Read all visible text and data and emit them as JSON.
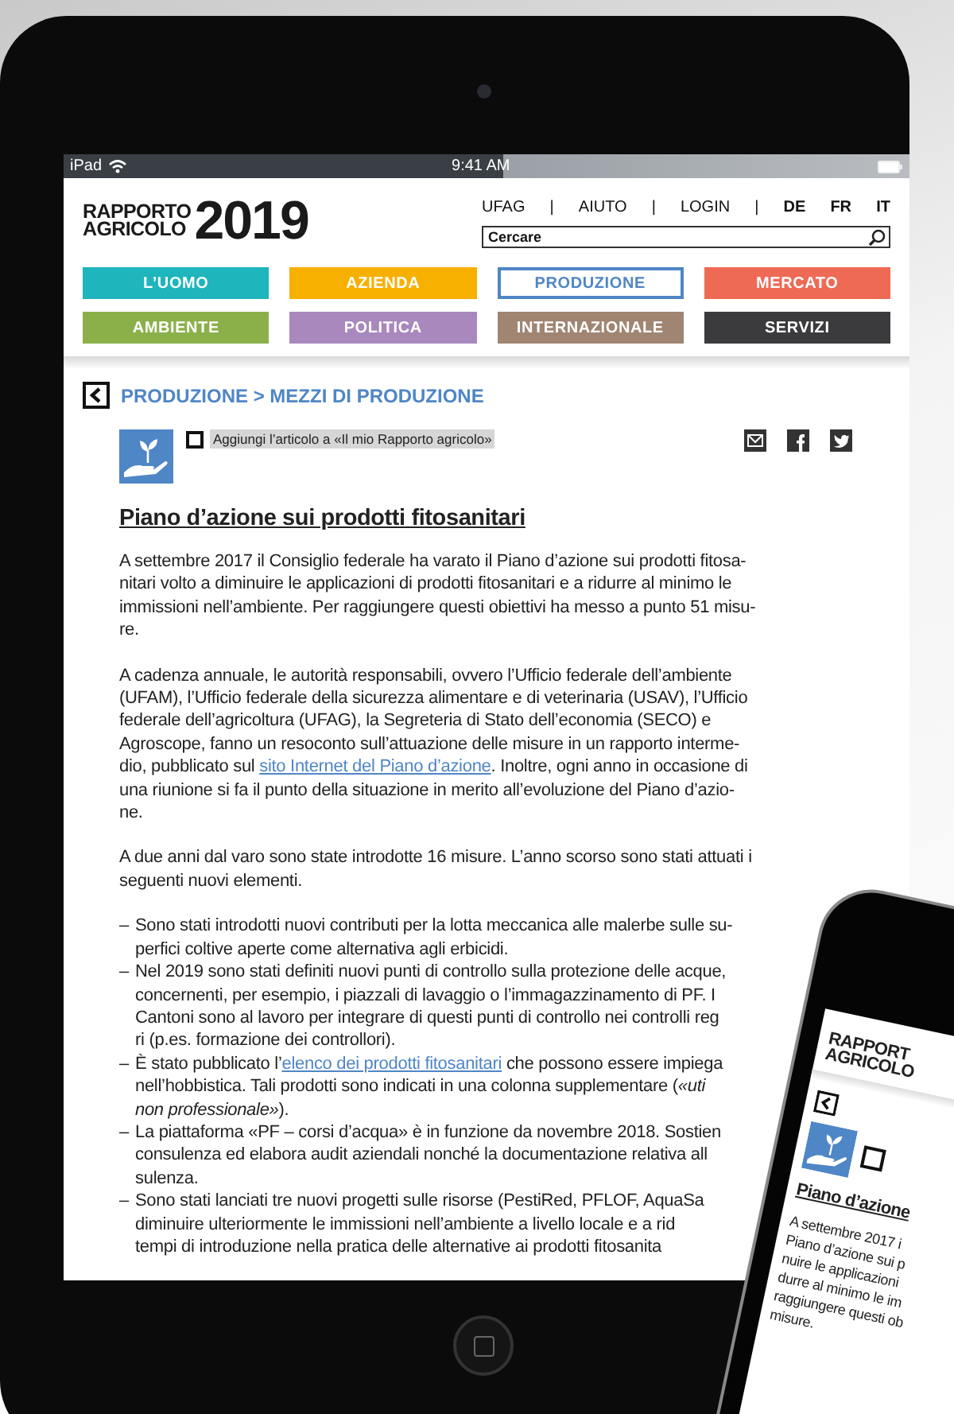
{
  "status_bar": {
    "device": "iPad",
    "time": "9:41 AM"
  },
  "header": {
    "logo_line_1": "RAPPORTO",
    "logo_line_2": "AGRICOLO",
    "logo_year": "2019",
    "top_links": [
      {
        "kind": "link",
        "label": "UFAG"
      },
      {
        "kind": "separator",
        "label": "|"
      },
      {
        "kind": "link",
        "label": "AIUTO"
      },
      {
        "kind": "separator",
        "label": "|"
      },
      {
        "kind": "link",
        "label": "LOGIN"
      },
      {
        "kind": "separator",
        "label": "|"
      },
      {
        "kind": "language",
        "label": "DE"
      },
      {
        "kind": "language",
        "label": "FR"
      },
      {
        "kind": "language",
        "label": "IT"
      }
    ],
    "search": {
      "placeholder": "Cercare"
    }
  },
  "nav": {
    "items": [
      {
        "label": "L’UOMO",
        "color": "#1fb5bd",
        "selected": false
      },
      {
        "label": "AZIENDA",
        "color": "#f7b000",
        "selected": false
      },
      {
        "label": "PRODUZIONE",
        "color": "#4f86c6",
        "selected": true
      },
      {
        "label": "MERCATO",
        "color": "#ee6a55",
        "selected": false
      },
      {
        "label": "AMBIENTE",
        "color": "#8bb04a",
        "selected": false
      },
      {
        "label": "POLITICA",
        "color": "#a888bd",
        "selected": false
      },
      {
        "label": "INTERNAZIONALE",
        "color": "#a08572",
        "selected": false
      },
      {
        "label": "SERVIZI",
        "color": "#3b3b3d",
        "selected": false
      }
    ]
  },
  "article": {
    "breadcrumb": "PRODUZIONE > MEZZI DI PRODUZIONE",
    "bookmark": {
      "label": "Aggiungi l’articolo a «Il mio Rapporto agricolo»",
      "checked": false
    },
    "title": "Piano d’azione sui prodotti fitosanitari",
    "blocks": [
      {
        "kind": "paragraph",
        "lines": [
          "A settembre 2017 il Consiglio federale ha varato il Piano d’azione sui prodotti fitosa-",
          "nitari volto a diminuire le applicazioni di prodotti fitosanitari e a ridurre al minimo le",
          "immissioni nell’ambiente. Per raggiungere questi obiettivi ha messo a punto 51 misu-",
          "re."
        ]
      },
      {
        "kind": "paragraph",
        "lines": [
          "A cadenza annuale, le autorità responsabili, ovvero l’Ufficio federale dell’ambiente",
          "(UFAM), l’Ufficio federale della sicurezza alimentare e di veterinaria (USAV), l’Ufficio",
          "federale dell’agricoltura (UFAG), la Segreteria di Stato dell’economia (SECO) e",
          "Agroscope, fanno un resoconto sull’attuazione delle misure in un rapporto interme-",
          [
            {
              "kind": "text",
              "text": "dio, pubblicato sul "
            },
            {
              "kind": "link",
              "text": "sito Internet del Piano d’azione"
            },
            {
              "kind": "text",
              "text": ". Inoltre, ogni anno in occasione di"
            }
          ],
          "una riunione si fa il punto della situazione in merito all’evoluzione del Piano d’azio-",
          "ne."
        ]
      },
      {
        "kind": "paragraph",
        "lines": [
          "A due anni dal varo sono state introdotte 16 misure. L’anno scorso sono stati attuati i",
          "seguenti nuovi elementi."
        ]
      },
      {
        "kind": "bullet",
        "marker": "–",
        "lines": [
          "Sono stati introdotti nuovi contributi per la lotta meccanica alle malerbe sulle su-",
          "perfici coltive aperte come alternativa agli erbicidi."
        ]
      },
      {
        "kind": "bullet",
        "marker": "–",
        "lines": [
          "Nel 2019 sono stati definiti nuovi punti di controllo sulla protezione delle acque,",
          "concernenti, per esempio, i piazzali di lavaggio o l’immagazzinamento di PF. I",
          "Cantoni sono al lavoro per integrare di questi punti di controllo nei controlli reg",
          "ri (p.es. formazione dei controllori)."
        ]
      },
      {
        "kind": "bullet",
        "marker": "–",
        "lines": [
          [
            {
              "kind": "text",
              "text": "È stato pubblicato l’"
            },
            {
              "kind": "link",
              "text": "elenco dei prodotti fitosanitari"
            },
            {
              "kind": "text",
              "text": " che possono essere impiega"
            }
          ],
          "nell’hobbistica. Tali prodotti sono indicati in una colonna supplementare (*«uti*",
          "*non professionale»*)."
        ]
      },
      {
        "kind": "bullet",
        "marker": "–",
        "lines": [
          "La piattaforma «PF – corsi d’acqua» è in funzione da novembre 2018. Sostien",
          "consulenza ed elabora audit aziendali nonché la documentazione relativa all",
          "sulenza."
        ]
      },
      {
        "kind": "bullet",
        "marker": "–",
        "lines": [
          "Sono stati lanciati tre nuovi progetti sulle risorse (PestiRed, PFLOF, AquaSa",
          "diminuire ulteriormente le immissioni nell’ambiente a livello locale e a rid",
          "tempi di introduzione nella pratica delle alternative ai prodotti fitosanita"
        ]
      }
    ]
  },
  "phone": {
    "logo_line_1": "RAPPORT",
    "logo_line_2": "AGRICOLO",
    "checkbox_checked": false,
    "title": "Piano d’azione",
    "lines": [
      "A settembre 2017 i",
      "Piano d’azione sui p",
      "nuire le applicazioni",
      "durre al minimo le im",
      "raggiungere questi ob",
      "misure."
    ]
  }
}
